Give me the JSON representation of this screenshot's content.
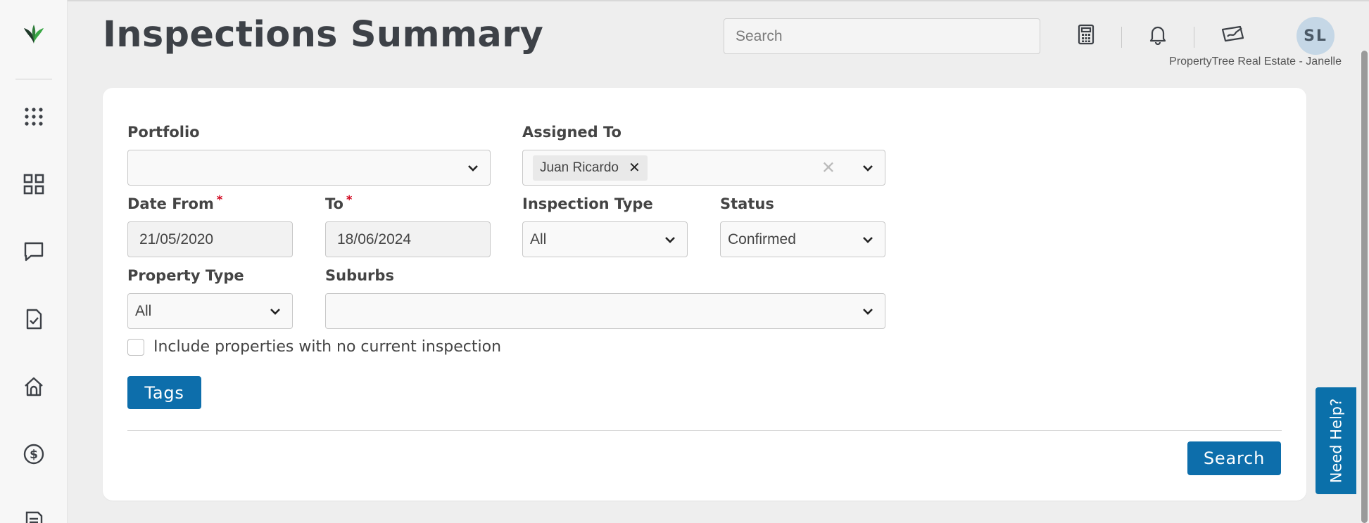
{
  "header": {
    "title": "Inspections Summary",
    "search_placeholder": "Search",
    "avatar_initials": "SL",
    "company": "PropertyTree Real Estate - Janelle"
  },
  "sidebar": {
    "icons": [
      "app-launcher-icon",
      "dashboard-icon",
      "messages-icon",
      "tasks-icon",
      "properties-icon",
      "financials-icon",
      "documents-icon"
    ]
  },
  "form": {
    "portfolio": {
      "label": "Portfolio",
      "value": ""
    },
    "assigned_to": {
      "label": "Assigned To",
      "chips": [
        "Juan Ricardo"
      ]
    },
    "date_from": {
      "label": "Date From",
      "required_mark": "*",
      "value": "21/05/2020"
    },
    "date_to": {
      "label": "To",
      "required_mark": "*",
      "value": "18/06/2024"
    },
    "inspection_type": {
      "label": "Inspection Type",
      "value": "All"
    },
    "status": {
      "label": "Status",
      "value": "Confirmed"
    },
    "property_type": {
      "label": "Property Type",
      "value": "All"
    },
    "suburbs": {
      "label": "Suburbs",
      "value": ""
    },
    "include_no_inspection": {
      "label": "Include properties with no current inspection",
      "checked": false
    },
    "tags_button": "Tags",
    "search_button": "Search"
  },
  "help": {
    "label": "Need Help?"
  },
  "colors": {
    "primary": "#0d6eab",
    "required": "#d0021b",
    "logo_dark": "#1f3a2a",
    "logo_green": "#3aa845"
  }
}
